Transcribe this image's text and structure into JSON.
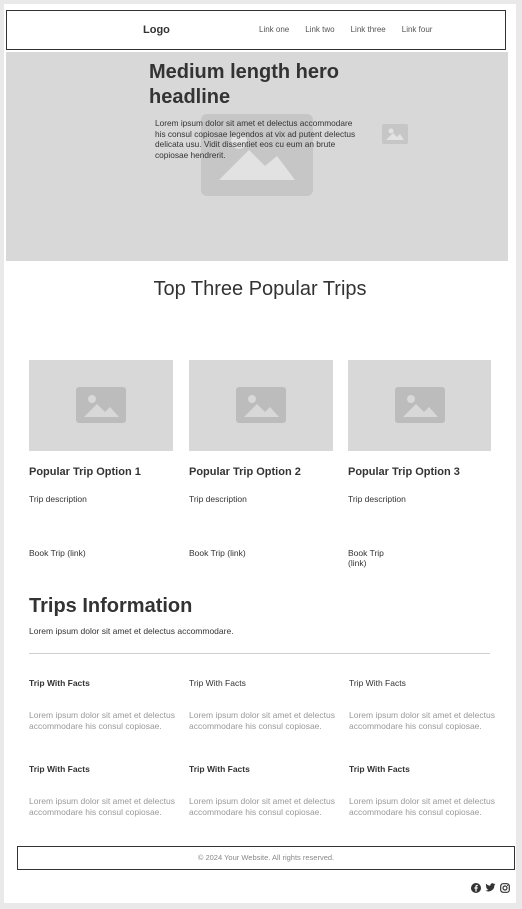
{
  "header": {
    "logo": "Logo",
    "nav": [
      "Link one",
      "Link two",
      "Link three",
      "Link four"
    ]
  },
  "hero": {
    "title": "Medium length hero headline",
    "text": "Lorem ipsum dolor sit amet et delectus accommodare his consul copiosae legendos at vix ad putent delectus delicata usu. Vidit dissentiet eos cu eum an brute copiosae hendrerit."
  },
  "popular": {
    "title": "Top Three Popular Trips",
    "cards": [
      {
        "title": "Popular Trip Option 1",
        "desc": "Trip description",
        "link": "Book Trip (link)"
      },
      {
        "title": "Popular Trip Option 2",
        "desc": "Trip description",
        "link": "Book Trip (link)"
      },
      {
        "title": "Popular Trip Option 3",
        "desc": "Trip description",
        "link": "Book Trip (link)"
      }
    ]
  },
  "info": {
    "title": "Trips Information",
    "subtitle": "Lorem ipsum dolor sit amet et delectus accommodare.",
    "facts": [
      {
        "title": "Trip With Facts",
        "text": "Lorem ipsum dolor sit amet et delectus accommodare his consul copiosae."
      },
      {
        "title": "Trip With Facts",
        "text": "Lorem ipsum dolor sit amet et delectus accommodare his consul copiosae."
      },
      {
        "title": "Trip With Facts",
        "text": "Lorem ipsum dolor sit amet et delectus accommodare his consul copiosae."
      },
      {
        "title": "Trip With Facts",
        "text": "Lorem ipsum dolor sit amet et delectus accommodare his consul copiosae."
      },
      {
        "title": "Trip With Facts",
        "text": "Lorem ipsum dolor sit amet et delectus accommodare his consul copiosae."
      },
      {
        "title": "Trip With Facts",
        "text": "Lorem ipsum dolor sit amet et delectus accommodare his consul copiosae."
      }
    ]
  },
  "footer": {
    "copyright": "© 2024 Your Website. All rights reserved.",
    "socials": [
      "facebook-icon",
      "twitter-icon",
      "instagram-icon"
    ]
  },
  "colors": {
    "placeholder_bg": "#d8d8d8",
    "placeholder_icon": "#b8b8b8",
    "text": "#333333",
    "muted_text": "#999999"
  }
}
